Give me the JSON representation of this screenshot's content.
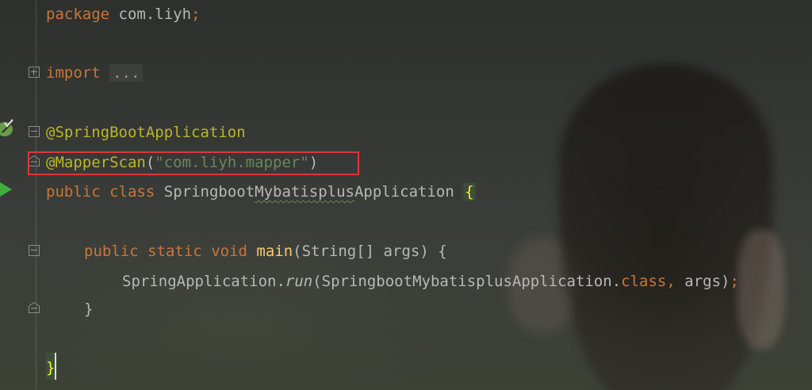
{
  "editor": {
    "language": "java",
    "lines": {
      "package_kw": "package",
      "package_name": " com.liyh",
      "package_semi": ";",
      "import_kw": "import",
      "import_folded": "...",
      "ann1": "@SpringBootApplication",
      "ann2": "@MapperScan",
      "ann2_open": "(",
      "ann2_arg": "\"com.liyh.mapper\"",
      "ann2_close": ")",
      "class_public": "public",
      "class_kw": "class",
      "class_name_a": "Springboot",
      "class_name_b": "Mybatisplus",
      "class_name_c": "Application",
      "class_open": "{",
      "main_public": "public",
      "main_static": "static",
      "main_void": "void",
      "main_name": "main",
      "main_params": "(String[] args) {",
      "call_target": "SpringApplication.",
      "call_method": "run",
      "call_args_a": "(SpringbootMybatisplusApplication.",
      "call_class_kw": "class,",
      "call_args_b": " args)",
      "call_semi": ";",
      "main_close": "}",
      "class_close": "}"
    },
    "colors": {
      "keyword": "#c8763a",
      "annotation": "#bbb529",
      "string": "#6a8759",
      "function": "#ffc66d",
      "text": "#b8b8b8",
      "highlight_box": "#e0353b"
    },
    "gutter": {
      "icons": [
        "spring-bean-icon",
        "run-icon"
      ]
    }
  }
}
